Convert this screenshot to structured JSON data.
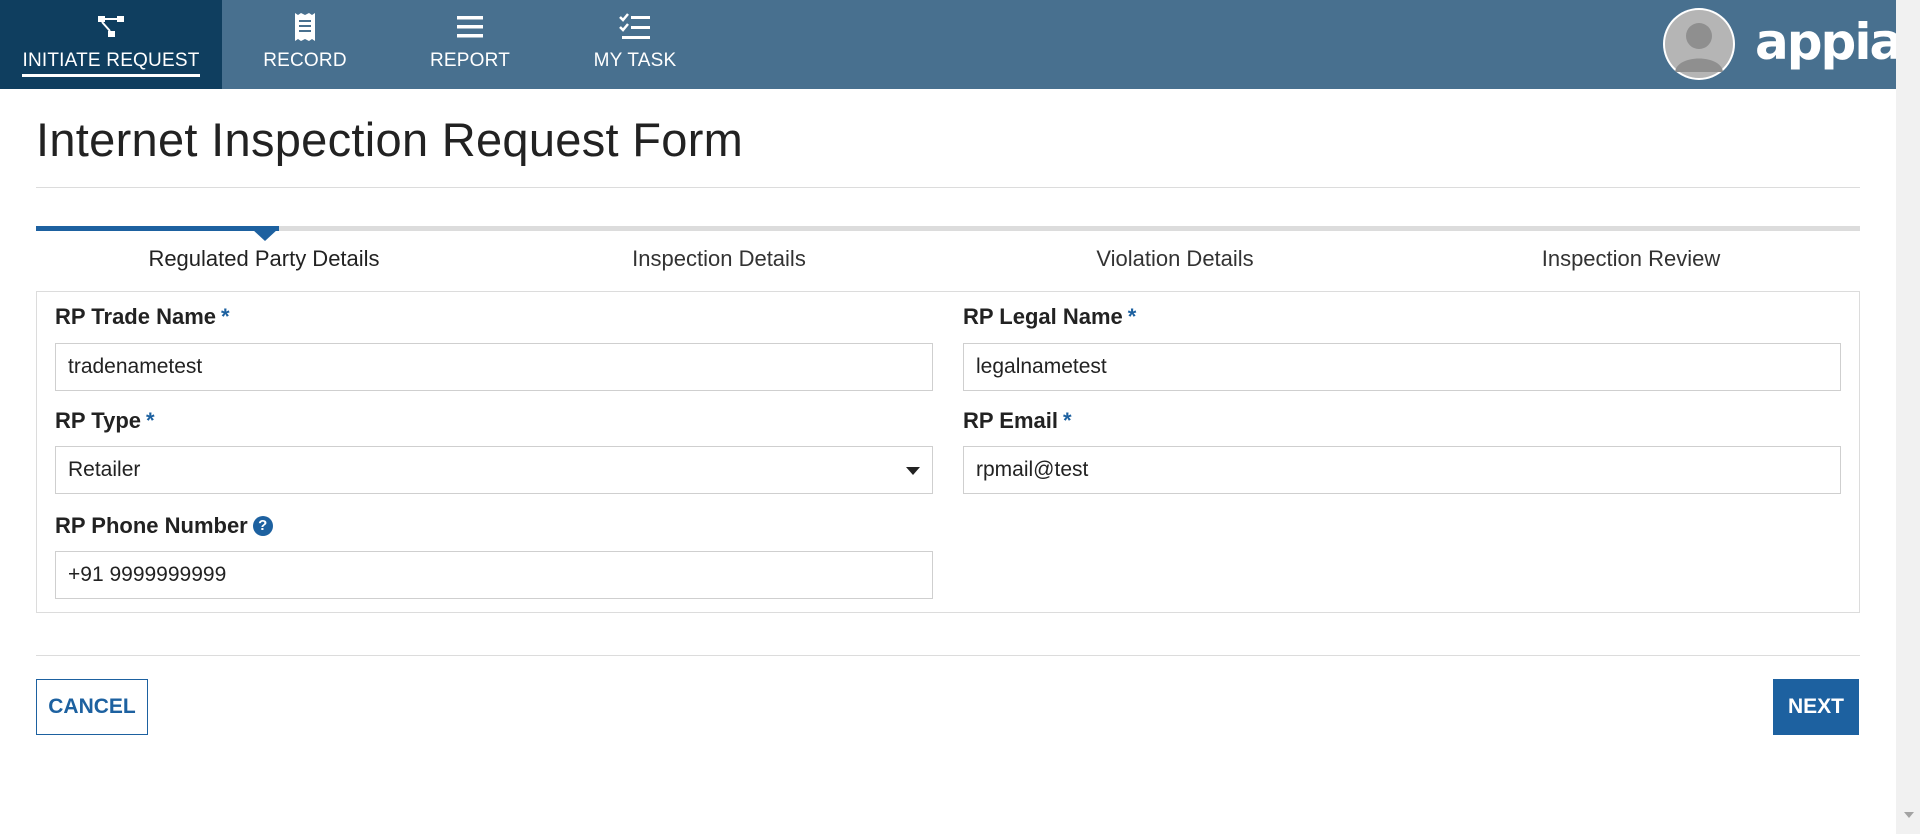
{
  "nav": {
    "items": [
      {
        "label": "INITIATE REQUEST",
        "icon": "process-flow-icon",
        "active": true
      },
      {
        "label": "RECORD",
        "icon": "receipt-icon"
      },
      {
        "label": "REPORT",
        "icon": "list-icon"
      },
      {
        "label": "MY TASK",
        "icon": "task-checklist-icon"
      }
    ],
    "brand": "appian",
    "colors": {
      "bar": "#48708f",
      "active": "#0f3e5f",
      "accent": "#1d61a0"
    }
  },
  "page": {
    "title": "Internet Inspection Request Form"
  },
  "steps": [
    {
      "label": "Regulated Party Details",
      "active": true
    },
    {
      "label": "Inspection Details"
    },
    {
      "label": "Violation Details"
    },
    {
      "label": "Inspection Review"
    }
  ],
  "form": {
    "trade_name": {
      "label": "RP Trade Name",
      "required_mark": "*",
      "value": "tradenametest"
    },
    "legal_name": {
      "label": "RP Legal Name",
      "required_mark": "*",
      "value": "legalnametest"
    },
    "rp_type": {
      "label": "RP Type",
      "required_mark": "*",
      "value": "Retailer"
    },
    "rp_email": {
      "label": "RP Email",
      "required_mark": "*",
      "value": "rpmail@test"
    },
    "phone": {
      "label": "RP Phone Number",
      "help_symbol": "?",
      "value": "+91 9999999999"
    }
  },
  "buttons": {
    "cancel": "CANCEL",
    "next": "NEXT"
  }
}
